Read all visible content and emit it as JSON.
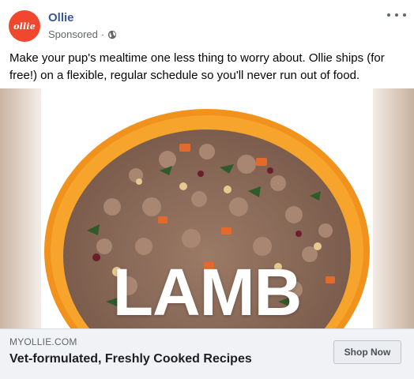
{
  "advertiser": {
    "logo_text": "ollie",
    "name": "Ollie",
    "sponsored_label": "Sponsored",
    "separator": "·",
    "audience_icon": "globe-icon",
    "brand_color": "#f0472f"
  },
  "menu": {
    "icon": "more-horizontal-icon"
  },
  "post": {
    "text": "Make your pup's mealtime one less thing to worry about. Ollie ships (for free!) on a flexible, regular schedule so you'll never run out of food."
  },
  "media": {
    "overlay_word": "LAMB"
  },
  "link": {
    "domain": "MYOLLIE.COM",
    "headline": "Vet-formulated, Freshly Cooked Recipes",
    "cta_label": "Shop Now"
  }
}
